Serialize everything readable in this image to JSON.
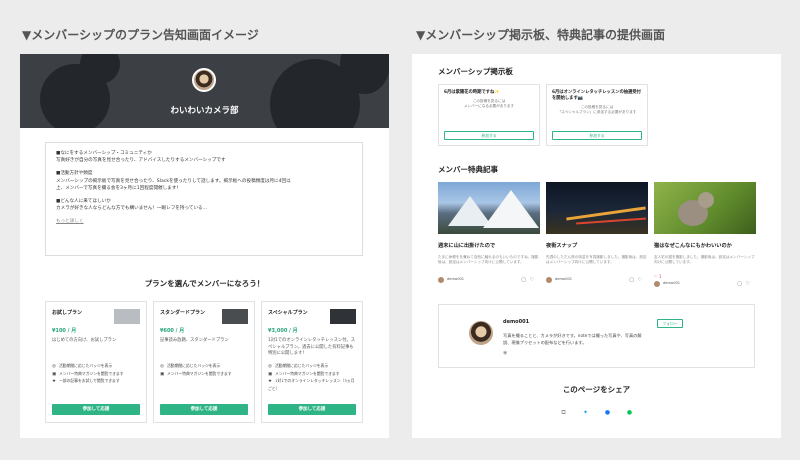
{
  "headings": {
    "left": "▼メンバーシップのプラン告知画面イメージ",
    "right": "▼メンバーシップ掲示板、特典記事の提供画面"
  },
  "left": {
    "group_name": "わいわいカメラ部",
    "description": [
      "■なにをするメンバーシップ・コミュニティか",
      "写真好きが自分の写真を見せ合ったり、アドバイスしたりするメンバーシップです",
      "■活動方針や頻度",
      "メンバーシップの掲示板で写真を見せ合ったり、Slackを使ったりして話します。掲示板への投稿頻度は月に4回以",
      "上、メンバーで写真を撮る会を3ヶ月に1回程度開催します！",
      "■どんな人に来てほしいか",
      "カメラが好きな人ならどんな方でも構いません！一眼レフを持っている..."
    ],
    "more_link": "もっと詳しく",
    "plans_title": "プランを選んでメンバーになろう！",
    "plans": [
      {
        "name": "お試しプラン",
        "price": "¥100 / 月",
        "desc": "はじめての方向け、お試しプラン",
        "benefits": [
          "活動期間に応じたバッジを表示",
          "メンバー特典マガジンを閲覧できます",
          "一部の記事をお試しで閲覧できます"
        ],
        "button": "参加して応援"
      },
      {
        "name": "スタンダードプラン",
        "price": "¥600 / 月",
        "desc": "記事読み放題、スタンダードプラン",
        "benefits": [
          "活動期間に応じたバッジを表示",
          "メンバー特典マガジンを閲覧できます"
        ],
        "button": "参加して応援"
      },
      {
        "name": "スペシャルプラン",
        "price": "¥3,000 / 月",
        "desc": "1対1でのオンラインレタッチレッスン付。スペシャルプラン。過去に公開した有料記事も特別に公開します！",
        "benefits": [
          "活動期間に応じたバッジを表示",
          "メンバー特典マガジンを閲覧できます",
          "1対1でのオンラインレタッチレッスン（3ヵ月ごと）"
        ],
        "button": "参加して応援"
      }
    ]
  },
  "right": {
    "board_title": "メンバーシップ掲示板",
    "posts": [
      {
        "title": "6月は紫陽花の時期ですね✨",
        "sub1": "この投稿を見るには",
        "sub2": "メンバーになる必要があります",
        "button": "参加する"
      },
      {
        "title": "6月はオンラインレタッチレッスンの抽選受付を開始します📷",
        "sub1": "この投稿を見るには",
        "sub2": "「スペシャルプラン」に参加する必要があります",
        "button": "参加する"
      }
    ],
    "articles_title": "メンバー特典記事",
    "articles": [
      {
        "title": "週末に山に出掛けたので",
        "excerpt": "たまに休暇をを兼ねて自然に触れるのもいいものですね。撮影後は、設定はメンバーシップ向けに公開しています。",
        "author": "demo001",
        "date": "6月前",
        "likes": ""
      },
      {
        "title": "夜街スナップ",
        "excerpt": "先週のしただん夜の街並を写真撮影しました。撮影後は、設定はメンバーシップ向けに公開しています。",
        "author": "demo001",
        "date": "6月前",
        "likes": ""
      },
      {
        "title": "猫はなぜこんなにもかわいいのか",
        "excerpt": "友人宅の猫を撮影しました。撮影後は、設定はメンバーシップ向けに公開しています。",
        "author": "demo001",
        "date": "6月前",
        "likes": "♡ 1"
      }
    ],
    "creator": {
      "name": "demo001",
      "bio1": "写真を撮ることと、カメラが好きです。noteでは撮った写真や、写真の解",
      "bio2": "説、現像プリセットの配布などを行います。",
      "follow": "フォロー"
    },
    "share_title": "このページをシェア"
  },
  "colors": {
    "accent": "#2eb485",
    "hero": "#3c3f44"
  }
}
